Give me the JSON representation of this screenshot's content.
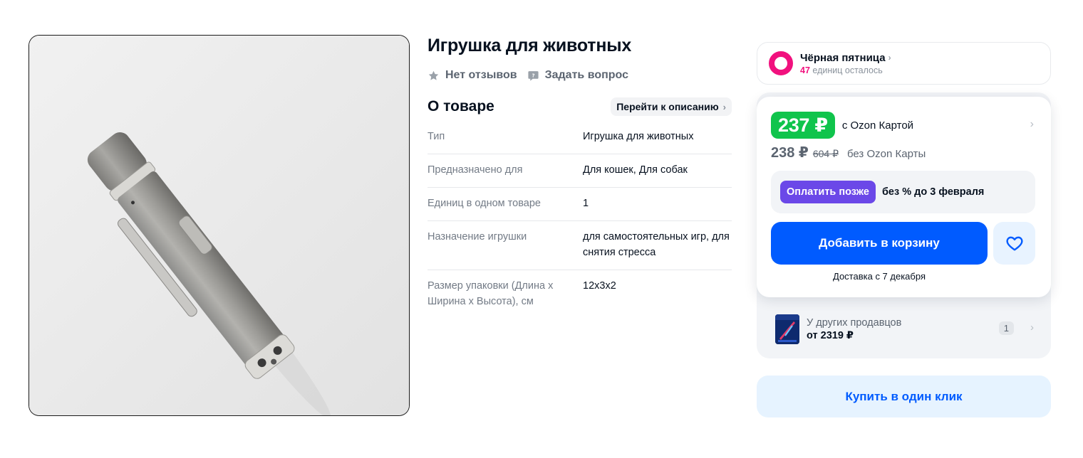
{
  "product": {
    "title": "Игрушка для животных",
    "reviews_label": "Нет отзывов",
    "ask_question_label": "Задать вопрос",
    "image_alt": "laser-pointer-photo"
  },
  "about": {
    "title": "О товаре",
    "goto_description_label": "Перейти к описанию",
    "specs": [
      {
        "key": "Тип",
        "value": "Игрушка для животных"
      },
      {
        "key": "Предназначено для",
        "value": "Для кошек, Для собак"
      },
      {
        "key": "Единиц в одном товаре",
        "value": "1"
      },
      {
        "key": "Назначение игрушки",
        "value": "для самостоятельных игр, для снятия стресса"
      },
      {
        "key": "Размер упаковки (Длина х Ширина х Высота), см",
        "value": "12х3х2"
      }
    ]
  },
  "promo": {
    "name": "Чёрная пятница",
    "remaining_count": "47",
    "remaining_text": "единиц осталось",
    "accent_color": "#f1117e"
  },
  "pricing": {
    "card_price": "237 ₽",
    "card_note": "с Ozon Картой",
    "regular_price": "238 ₽",
    "old_price": "604 ₽",
    "no_card_note": "без Ozon Карты",
    "card_price_color": "#10c44c"
  },
  "pay_later": {
    "badge": "Оплатить позже",
    "text": "без % до 3 февраля",
    "color": "#6b48e8"
  },
  "actions": {
    "add_to_cart": "Добавить в корзину",
    "delivery": "Доставка с 7 декабря",
    "favorite_icon": "heart-icon",
    "buy_one_click": "Купить в один клик",
    "primary_color": "#005bff"
  },
  "other_sellers": {
    "title": "У других продавцов",
    "price": "от 2319 ₽",
    "count": "1"
  }
}
